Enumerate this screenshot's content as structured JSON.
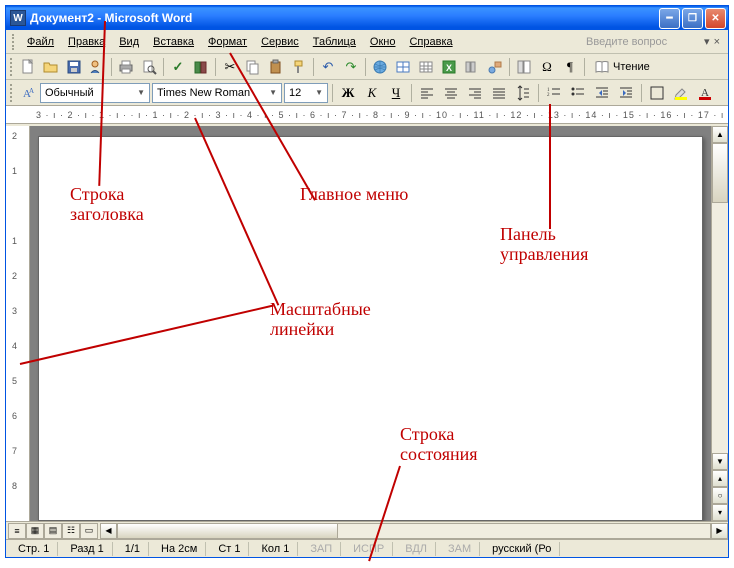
{
  "title": "Документ2 - Microsoft Word",
  "menu": {
    "file": "Файл",
    "edit": "Правка",
    "view": "Вид",
    "insert": "Вставка",
    "format": "Формат",
    "service": "Сервис",
    "table": "Таблица",
    "window": "Окно",
    "help": "Справка",
    "search_placeholder": "Введите вопрос"
  },
  "toolbar": {
    "read_label": "Чтение"
  },
  "format": {
    "style": "Обычный",
    "font": "Times New Roman",
    "size": "12",
    "bold": "Ж",
    "italic": "К",
    "underline": "Ч"
  },
  "ruler_h": "3 · ı · 2 · ı · 1 · ı ·    · ı · 1 · ı · 2 · ı · 3 · ı · 4 · ı · 5 · ı · 6 · ı · 7 · ı · 8 · ı · 9 · ı · 10 · ı · 11 · ı · 12 · ı · 13 · ı · 14 · ı · 15 · ı · 16 · ı · 17 · ı",
  "ruler_v": [
    "2",
    "1",
    "",
    "1",
    "2",
    "3",
    "4",
    "5",
    "6",
    "7",
    "8"
  ],
  "status": {
    "page": "Стр. 1",
    "section": "Разд 1",
    "pages": "1/1",
    "at": "На 2см",
    "line": "Ст 1",
    "col": "Кол 1",
    "rec": "ЗАП",
    "trk": "ИСПР",
    "ext": "ВДЛ",
    "ovr": "ЗАМ",
    "lang": "русский (Ро"
  },
  "annotations": {
    "title_bar": "Строка\nзаголовка",
    "main_menu": "Главное меню",
    "control_panel": "Панель\nуправления",
    "rulers": "Масштабные\nлинейки",
    "status_bar": "Строка\nсостояния"
  }
}
